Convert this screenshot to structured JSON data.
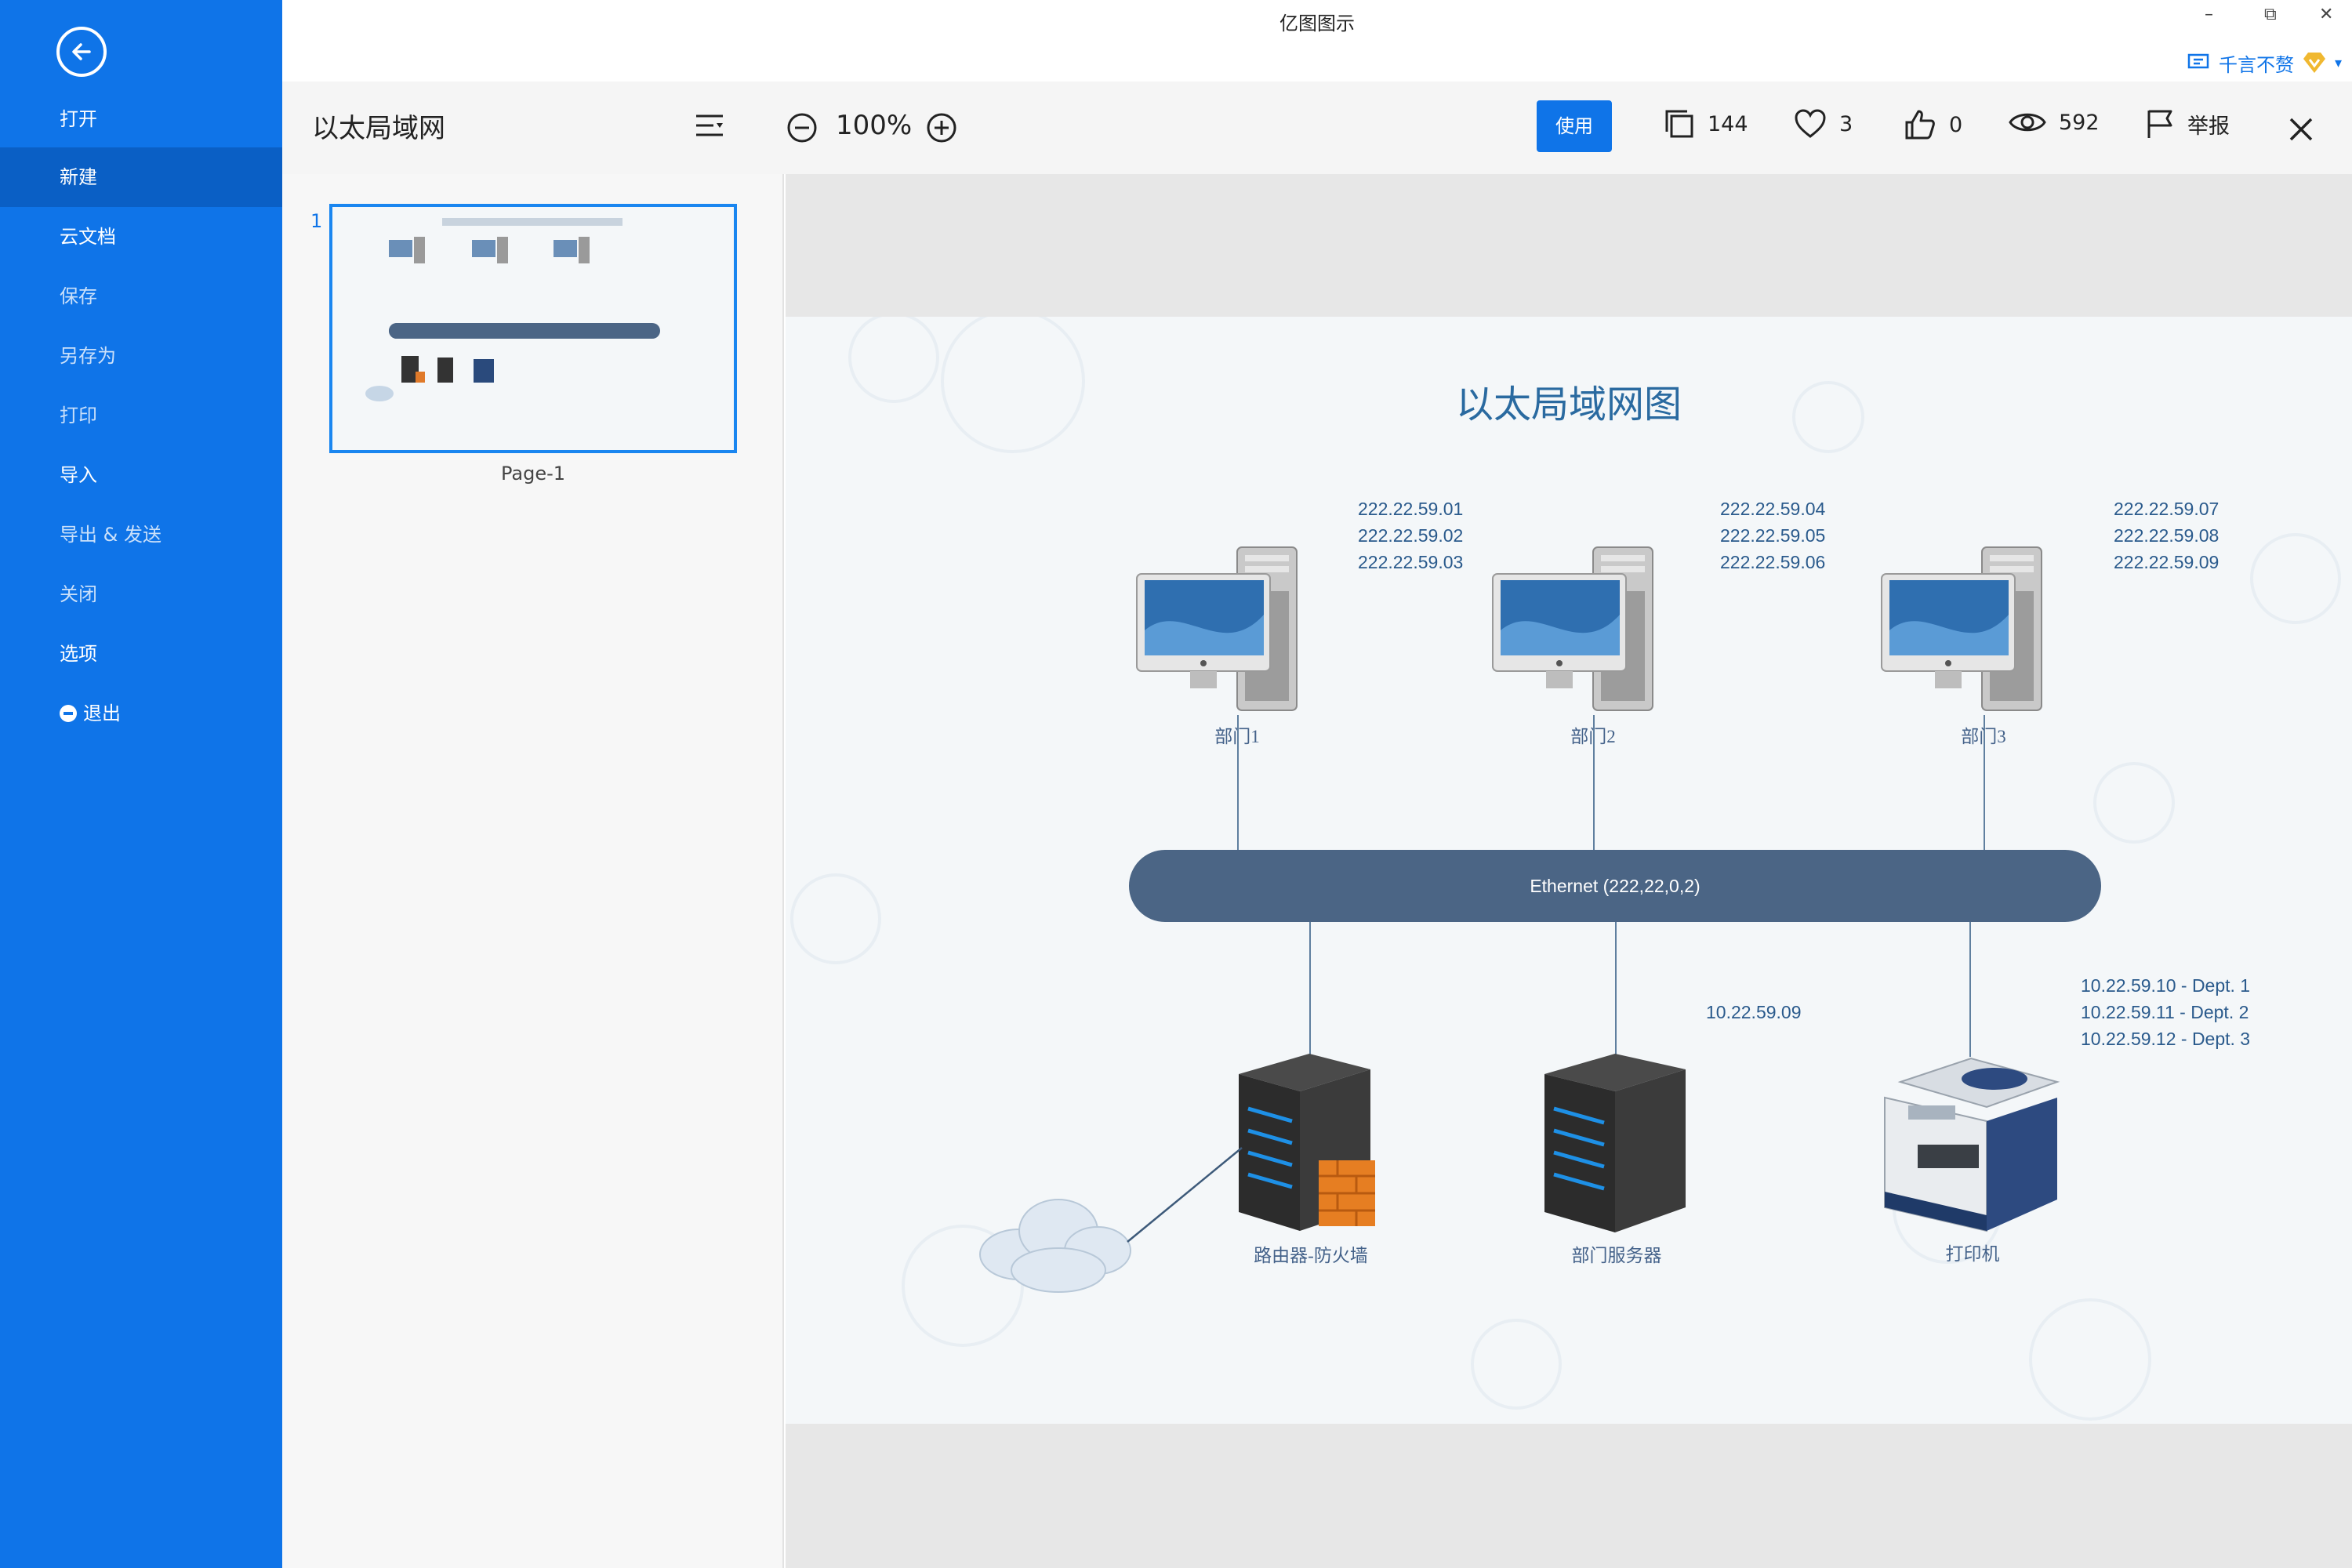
{
  "window": {
    "title": "亿图图示",
    "controls": [
      "–",
      "⧉",
      "✕"
    ]
  },
  "user": {
    "name": "千言不赘",
    "caret": "▾"
  },
  "sidebar": {
    "items": [
      {
        "label": "打开"
      },
      {
        "label": "新建"
      },
      {
        "label": "云文档"
      },
      {
        "label": "保存"
      },
      {
        "label": "另存为"
      },
      {
        "label": "打印"
      },
      {
        "label": "导入"
      },
      {
        "label": "导出 & 发送"
      },
      {
        "label": "关闭"
      },
      {
        "label": "选项"
      },
      {
        "label": "退出"
      }
    ]
  },
  "toolbar": {
    "doc_title": "以太局域网",
    "zoom": "100%",
    "use_label": "使用",
    "copies": "144",
    "favorites": "3",
    "likes": "0",
    "views": "592",
    "report_label": "举报"
  },
  "pages": [
    {
      "number": "1",
      "label": "Page-1"
    }
  ],
  "diagram": {
    "title": "以太局域网图",
    "computers": [
      {
        "label": "部门1",
        "ips": [
          "222.22.59.01",
          "222.22.59.02",
          "222.22.59.03"
        ]
      },
      {
        "label": "部门2",
        "ips": [
          "222.22.59.04",
          "222.22.59.05",
          "222.22.59.06"
        ]
      },
      {
        "label": "部门3",
        "ips": [
          "222.22.59.07",
          "222.22.59.08",
          "222.22.59.09"
        ]
      }
    ],
    "ethernet_label": "Ethernet (222,22,0,2)",
    "router_label": "路由器-防火墙",
    "server_label": "部门服务器",
    "server_ip": "10.22.59.09",
    "printer_label": "打印机",
    "printer_ips": [
      "10.22.59.10 - Dept. 1",
      "10.22.59.11 - Dept. 2",
      "10.22.59.12 - Dept. 3"
    ]
  },
  "colors": {
    "sidebar": "#0f74e8",
    "accent": "#0f74e8",
    "ethernet": "#4b6585",
    "diagram_text": "#2a5a8c"
  }
}
